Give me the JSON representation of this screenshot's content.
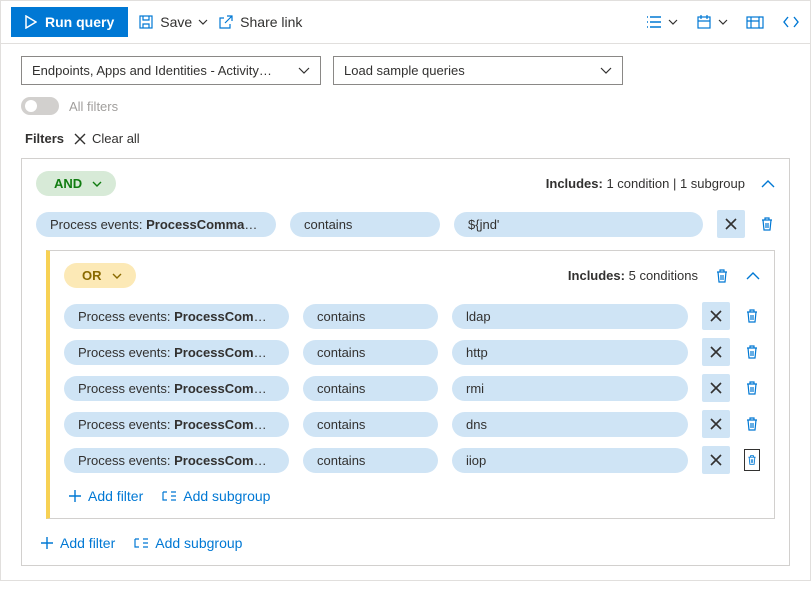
{
  "toolbar": {
    "run": "Run query",
    "save": "Save",
    "share": "Share link"
  },
  "scope_dropdown": "Endpoints, Apps and Identities - Activity…",
  "sample_dropdown": "Load sample queries",
  "all_filters_label": "All filters",
  "filters_label": "Filters",
  "clear_all": "Clear all",
  "root_group": {
    "op": "AND",
    "summary_prefix": "Includes:",
    "summary": "1 condition | 1 subgroup",
    "condition": {
      "field_prefix": "Process events: ",
      "field": "ProcessComman…",
      "operator": "contains",
      "value": "${jnd'"
    }
  },
  "sub_group": {
    "op": "OR",
    "summary_prefix": "Includes:",
    "summary": "5 conditions",
    "conditions": [
      {
        "field_prefix": "Process events: ",
        "field": "ProcessComman…",
        "operator": "contains",
        "value": "ldap"
      },
      {
        "field_prefix": "Process events: ",
        "field": "ProcessComman…",
        "operator": "contains",
        "value": "http"
      },
      {
        "field_prefix": "Process events: ",
        "field": "ProcessComman…",
        "operator": "contains",
        "value": "rmi"
      },
      {
        "field_prefix": "Process events: ",
        "field": "ProcessComman…",
        "operator": "contains",
        "value": "dns"
      },
      {
        "field_prefix": "Process events: ",
        "field": "ProcessComman…",
        "operator": "contains",
        "value": "iiop"
      }
    ]
  },
  "add_filter": "Add filter",
  "add_subgroup": "Add subgroup"
}
